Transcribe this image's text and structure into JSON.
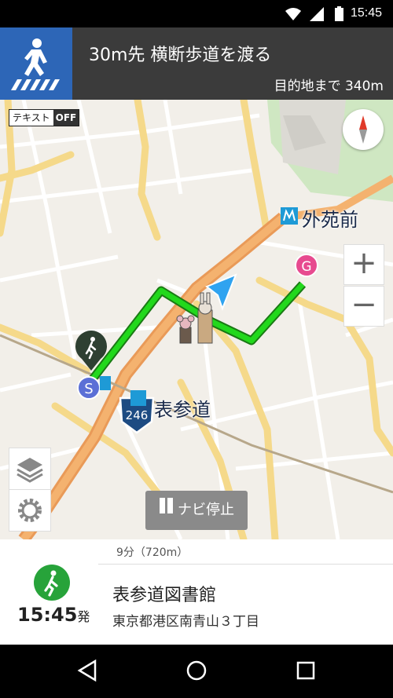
{
  "status_bar": {
    "time": "15:45",
    "icons": [
      "wifi-icon",
      "signal-icon",
      "battery-icon"
    ]
  },
  "nav_header": {
    "icon": "pedestrian-crossing-icon",
    "instruction": "30m先 横断歩道を渡る",
    "remaining": "目的地まで 340m",
    "colors": {
      "icon_bg": "#2d66b7",
      "bg": "#3b3b3b"
    }
  },
  "map": {
    "text_toggle": {
      "label": "テキスト",
      "state": "OFF"
    },
    "compass_icon": "compass-icon",
    "zoom_in_label": "+",
    "zoom_out_label": "−",
    "stop_nav_label": "ナビ停止",
    "labels": {
      "gaienmae": "外苑前",
      "omotesando": "表参道",
      "route_number": "246"
    },
    "markers": {
      "start": "S",
      "goal": "G"
    },
    "route_color": "#22d81c"
  },
  "bottom_panel": {
    "duration": "9分（720m）",
    "departure_time": "15:45",
    "departure_suffix": "発",
    "destination": "表参道図書館",
    "address": "東京都港区南青山３丁目",
    "walk_icon": "walking-person-icon"
  },
  "android_nav": {
    "buttons": [
      "back-icon",
      "home-icon",
      "recents-icon"
    ]
  }
}
